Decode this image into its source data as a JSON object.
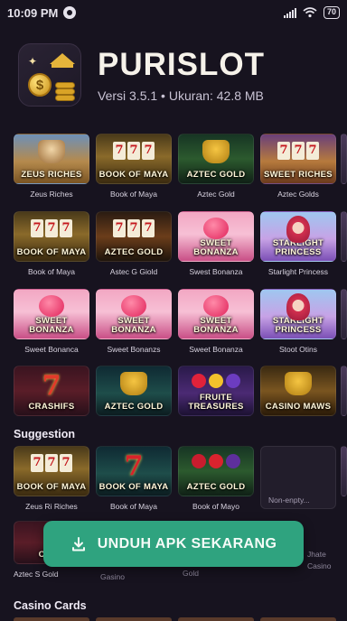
{
  "status_bar": {
    "time": "10:09 PM",
    "battery": "70"
  },
  "app": {
    "title": "PURISLOT",
    "meta": "Versi 3.5.1 • Ukuran: 42.8 MB",
    "logo_mark": "$"
  },
  "games_row1": [
    {
      "logo": "ZEUS RICHES",
      "caption": "Zeus Riches"
    },
    {
      "logo": "BOOK OF MAYA",
      "caption": "Book of Maya"
    },
    {
      "logo": "AZTEC GOLD",
      "caption": "Aztec Gold"
    },
    {
      "logo": "SWEET RICHES",
      "caption": "Aztec Golds"
    }
  ],
  "games_row2": [
    {
      "logo": "BOOK OF MAYA",
      "caption": "Book of Maya"
    },
    {
      "logo": "AZTEC GOLD",
      "caption": "Astec G Giold"
    },
    {
      "logo": "SWEET BONANZA",
      "caption": "Swest Bonanza"
    },
    {
      "logo": "STARLIGHT PRINCESS",
      "caption": "Starlight Princess"
    }
  ],
  "games_row3": [
    {
      "logo": "SWEET BONANZA",
      "caption": "Sweet Bonanca"
    },
    {
      "logo": "SWEET BONANZA",
      "caption": "Sweet Bonanzs"
    },
    {
      "logo": "SWEET BONANZA",
      "caption": "Sweet Bonanza"
    },
    {
      "logo": "STARLIGHT PRINCESS",
      "caption": "Stoot Otins"
    }
  ],
  "games_row4": [
    {
      "logo": "CRASHIFS"
    },
    {
      "logo": "AZTEC GOLD"
    },
    {
      "logo": "FRUITE TREASURES"
    },
    {
      "logo": "CASINO MAWS"
    }
  ],
  "suggestion": {
    "heading": "Suggestion",
    "items": [
      {
        "logo": "BOOK OF MAYA",
        "caption": "Zeus Ri Riches"
      },
      {
        "logo": "BOOK OF MAYA",
        "caption": "Book of Maya"
      },
      {
        "logo": "AZTEC GOLD",
        "caption": "Book of Mayo"
      },
      {
        "logo": "",
        "caption": "Non-enpty..."
      }
    ],
    "row2_captions": [
      "Aztec S Gold",
      "Gasino",
      "Gold",
      "Jhate",
      "Casino"
    ],
    "row2_logo": "CRAB"
  },
  "download_button": {
    "label": "UNDUH APK SEKARANG"
  },
  "casino_cards": {
    "heading": "Casino Cards"
  },
  "colors": {
    "accent": "#2fa37f",
    "background": "#17131f"
  }
}
